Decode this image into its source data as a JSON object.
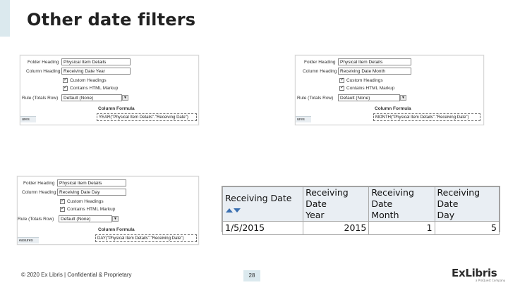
{
  "title": "Other date filters",
  "panels": {
    "year": {
      "folder_heading_label": "Folder Heading",
      "folder_heading_value": "Physical Item Details",
      "column_heading_label": "Column Heading",
      "column_heading_value": "Receiving Date Year",
      "custom_headings_label": "Custom Headings",
      "contains_html_label": "Contains HTML Markup",
      "rule_label": "Rule (Totals Row)",
      "rule_value": "Default (None)",
      "column_formula_label": "Column Formula",
      "formula_value": "YEAR(\"Physical Item Details\".\"Receiving Date\")",
      "strip_label": "ures"
    },
    "month": {
      "folder_heading_label": "Folder Heading",
      "folder_heading_value": "Physical Item Details",
      "column_heading_label": "Column Heading",
      "column_heading_value": "Receiving Date Month",
      "custom_headings_label": "Custom Headings",
      "contains_html_label": "Contains HTML Markup",
      "rule_label": "Rule (Totals Row)",
      "rule_value": "Default (None)",
      "column_formula_label": "Column Formula",
      "formula_value": "MONTH(\"Physical Item Details\".\"Receiving Date\")",
      "strip_label": "ures"
    },
    "day": {
      "folder_heading_label": "Folder Heading",
      "folder_heading_value": "Physical Item Details",
      "column_heading_label": "Column Heading",
      "column_heading_value": "Receiving Date Day",
      "custom_headings_label": "Custom Headings",
      "contains_html_label": "Contains HTML Markup",
      "rule_label": "Rule (Totals Row)",
      "rule_value": "Default (None)",
      "column_formula_label": "Column Formula",
      "formula_value": "DAY(\"Physical Item Details\".\"Receiving Date\")",
      "strip_label": "easures"
    }
  },
  "report": {
    "headers": [
      "Receiving Date",
      "Receiving Date Year",
      "Receiving Date Month",
      "Receiving Date Day"
    ],
    "header_lines": [
      [
        "Receiving Date"
      ],
      [
        "Receiving Date",
        "Year"
      ],
      [
        "Receiving Date",
        "Month"
      ],
      [
        "Receiving Date",
        "Day"
      ]
    ],
    "rows": [
      [
        "1/5/2015",
        "2015",
        "1",
        "5"
      ]
    ]
  },
  "footer": {
    "copyright": "© 2020 Ex Libris | Confidential & Proprietary",
    "page_number": "28",
    "logo_text": "ExLibris",
    "logo_sub": "a ProQuest Company"
  },
  "colors": {
    "accent": "#dbe9ee",
    "sort_icon": "#3a6fb0",
    "header_bg": "#e9eef3"
  }
}
